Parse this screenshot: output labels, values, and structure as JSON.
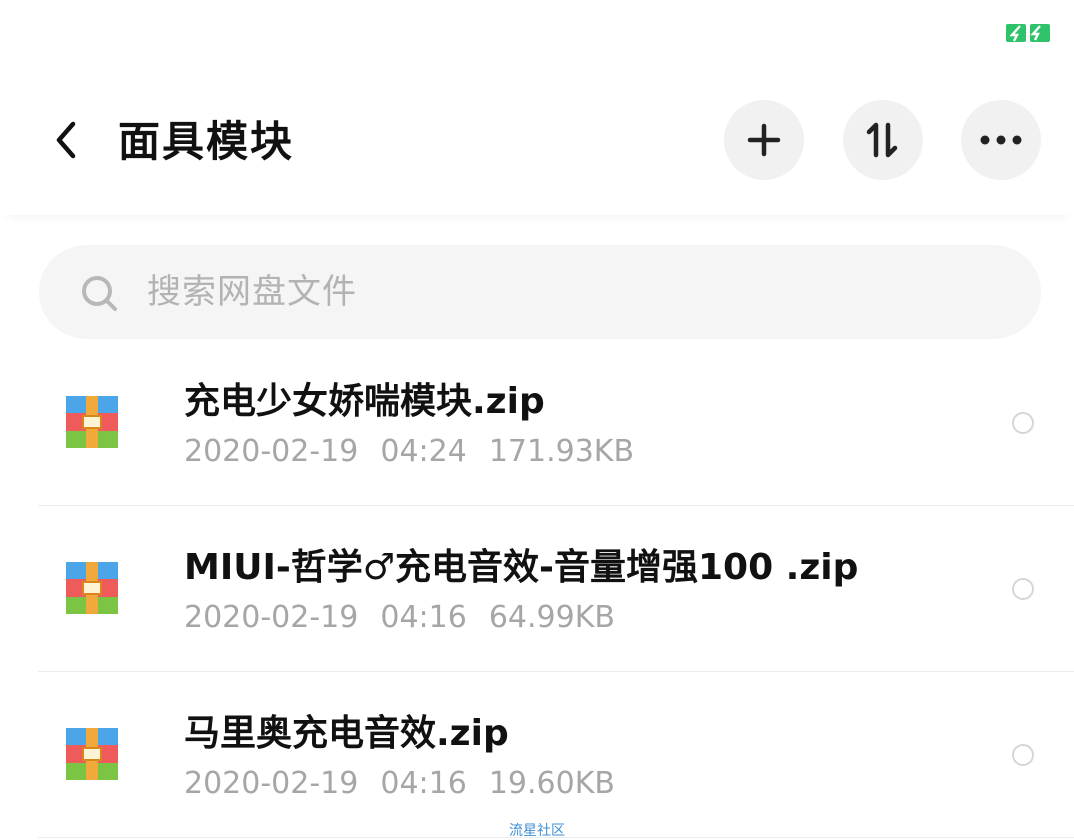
{
  "status_bar": {
    "battery_icon": "battery-charging-icon",
    "battery_color": "#2ec26b"
  },
  "header": {
    "back_icon": "chevron-left-icon",
    "title": "面具模块",
    "actions": [
      {
        "name": "add-button",
        "icon": "plus-icon"
      },
      {
        "name": "sort-button",
        "icon": "sort-icon"
      },
      {
        "name": "more-button",
        "icon": "more-dots-icon"
      }
    ]
  },
  "search": {
    "icon": "search-icon",
    "placeholder": "搜索网盘文件"
  },
  "files": [
    {
      "icon": "zip-archive-icon",
      "name": "充电少女娇喘模块.zip",
      "date": "2020-02-19",
      "time": "04:24",
      "size": "171.93KB",
      "selected": false
    },
    {
      "icon": "zip-archive-icon",
      "name": "MIUI-哲学♂充电音效-音量增强100 .zip",
      "date": "2020-02-19",
      "time": "04:16",
      "size": "64.99KB",
      "selected": false
    },
    {
      "icon": "zip-archive-icon",
      "name": "马里奥充电音效.zip",
      "date": "2020-02-19",
      "time": "04:16",
      "size": "19.60KB",
      "selected": false
    }
  ],
  "watermark": "流星社区",
  "colors": {
    "accent_green": "#2ec26b",
    "zip_blue": "#4aa6e8",
    "zip_red": "#ef5b5b",
    "zip_green": "#7cc443",
    "zip_strap": "#f2a93b",
    "watermark_blue": "#3f8fd6"
  }
}
